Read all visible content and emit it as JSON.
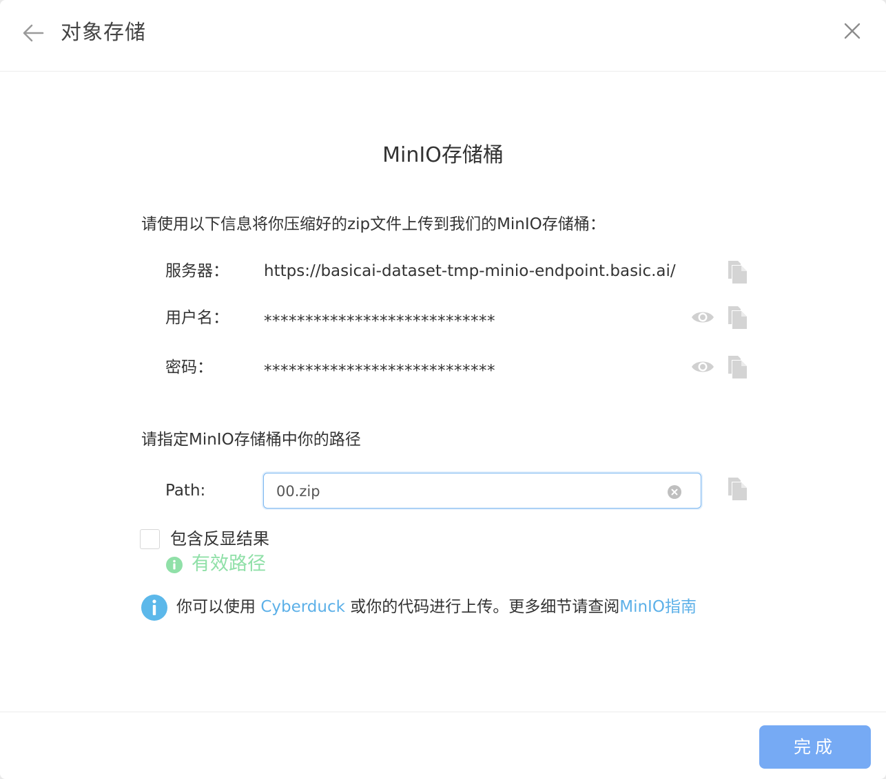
{
  "header": {
    "title": "对象存储",
    "back_icon": "arrow-left-icon",
    "close_icon": "close-icon"
  },
  "main": {
    "section_title": "MinIO存储桶",
    "intro": "请使用以下信息将你压缩好的zip文件上传到我们的MinIO存储桶：",
    "server": {
      "label": "服务器：",
      "value": "https://basicai-dataset-tmp-minio-endpoint.basic.ai/"
    },
    "username": {
      "label": "用户名：",
      "value": "****************************"
    },
    "password": {
      "label": "密码：",
      "value": "****************************"
    },
    "path_title": "请指定MinIO存储桶中你的路径",
    "path": {
      "label": "Path:",
      "value": "00.zip"
    },
    "include_checkbox_label": "包含反显结果",
    "include_checked": false,
    "valid_text": "有效路径",
    "info": {
      "prefix": "你可以使用 ",
      "cyberduck_link": "Cyberduck",
      "middle": " 或你的代码进行上传。更多细节请查阅",
      "guide_link": "MinIO指南"
    }
  },
  "footer": {
    "done_label": "完成"
  },
  "colors": {
    "accent": "#76aaf4",
    "link": "#5cb0e8",
    "valid": "#90e0a8",
    "icon_gray": "#d0d0d0"
  }
}
